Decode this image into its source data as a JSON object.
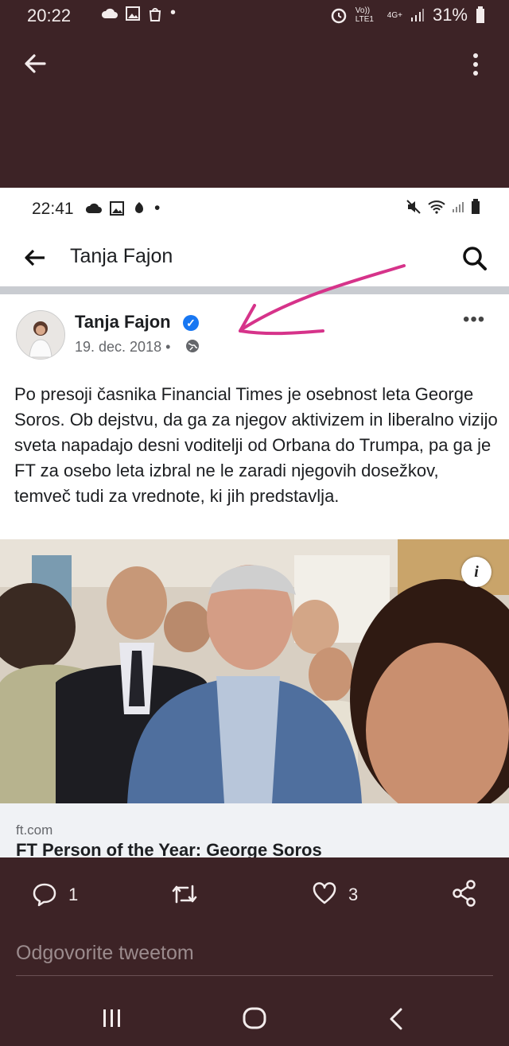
{
  "outer_status": {
    "time": "20:22",
    "network": "Vo)) LTE1",
    "signal_type": "4G+",
    "battery": "31%"
  },
  "inner_status": {
    "time": "22:41"
  },
  "fb": {
    "header_title": "Tanja Fajon",
    "post": {
      "author": "Tanja Fajon",
      "date": "19. dec. 2018 •",
      "text": "Po presoji časnika Financial Times je osebnost leta George Soros. Ob dejstvu, da ga za njegov aktivizem in liberalno vizijo sveta napadajo desni voditelji od Orbana do Trumpa, pa ga je FT za osebo leta izbral ne le zaradi njegovih dosežkov, temveč tudi za vrednote, ki jih predstavlja.",
      "link_domain": "ft.com",
      "link_title": "FT Person of the Year: George Soros"
    }
  },
  "tweet": {
    "reply_count": "1",
    "like_count": "3",
    "reply_placeholder": "Odgovorite tweetom"
  },
  "colors": {
    "background": "#3d2326",
    "annotation_arrow": "#d6338a",
    "fb_blue": "#1877f2"
  }
}
